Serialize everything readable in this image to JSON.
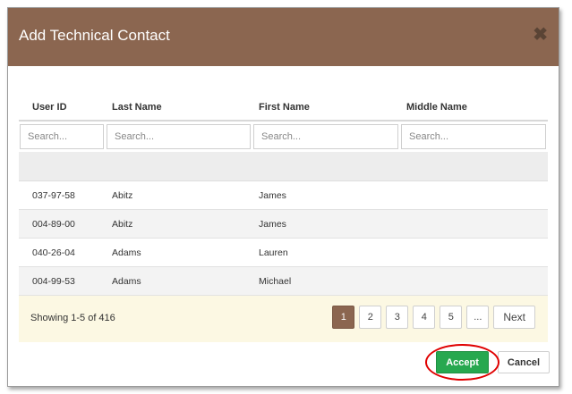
{
  "modal": {
    "title": "Add Technical Contact",
    "close_glyph": "✖"
  },
  "table": {
    "columns": [
      "User ID",
      "Last Name",
      "First Name",
      "Middle Name"
    ],
    "filter_placeholder": "Search...",
    "rows": [
      {
        "user_id": "037-97-58",
        "last_name": "Abitz",
        "first_name": "James",
        "middle_name": ""
      },
      {
        "user_id": "004-89-00",
        "last_name": "Abitz",
        "first_name": "James",
        "middle_name": ""
      },
      {
        "user_id": "040-26-04",
        "last_name": "Adams",
        "first_name": "Lauren",
        "middle_name": ""
      },
      {
        "user_id": "004-99-53",
        "last_name": "Adams",
        "first_name": "Michael",
        "middle_name": ""
      }
    ]
  },
  "footer": {
    "showing_text": "Showing 1-5 of 416",
    "pages": [
      "1",
      "2",
      "3",
      "4",
      "5",
      "..."
    ],
    "active_page": "1",
    "next_label": "Next"
  },
  "actions": {
    "accept_label": "Accept",
    "cancel_label": "Cancel"
  },
  "colors": {
    "header_brown": "#8b6650",
    "accept_green": "#27a84f",
    "footer_yellow": "#fcf8e3",
    "highlight_red": "#e00000"
  }
}
